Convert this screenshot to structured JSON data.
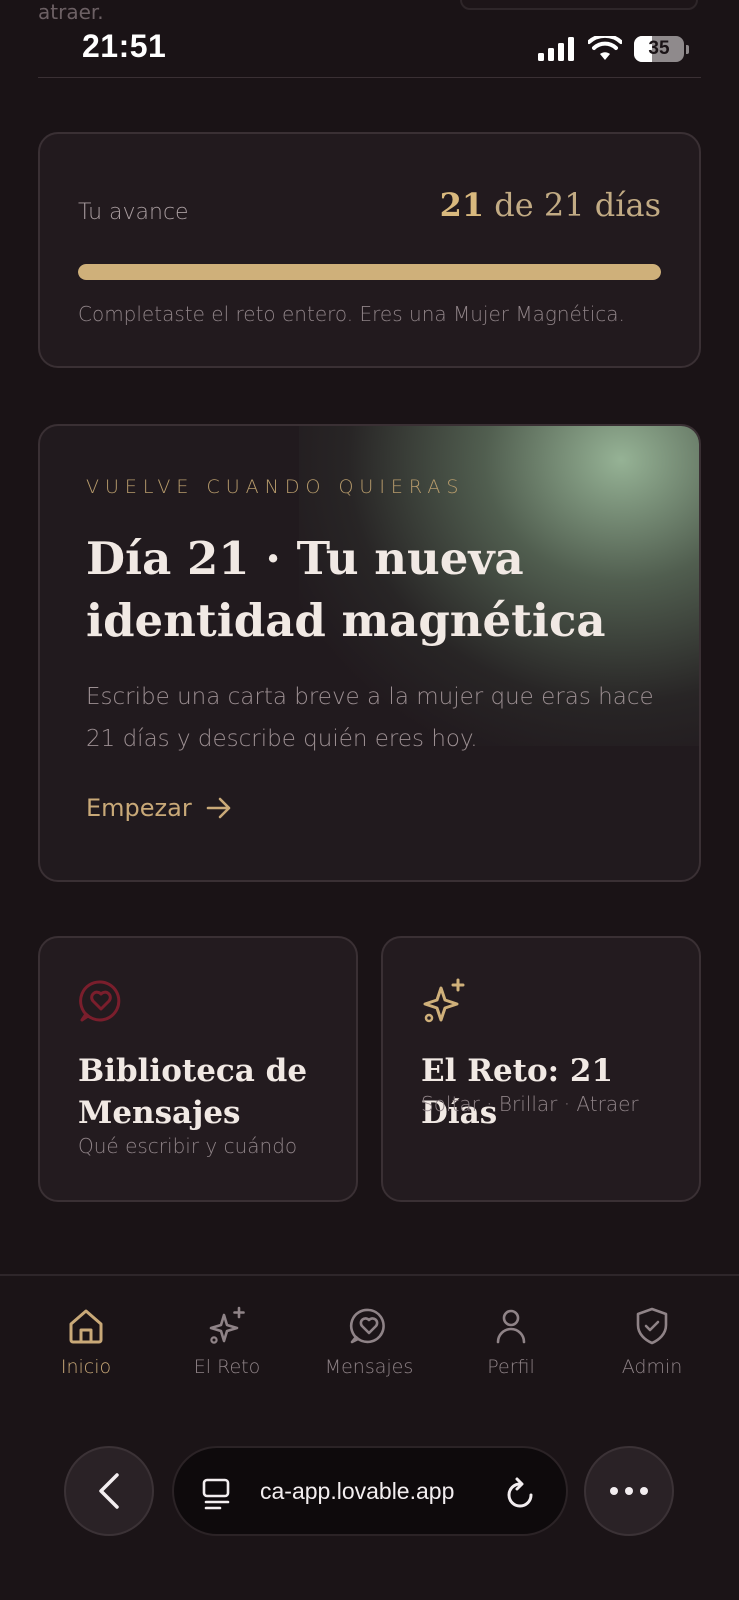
{
  "peek_text": "atraer.",
  "status": {
    "time": "21:51",
    "battery": "35"
  },
  "progress": {
    "label": "Tu avance",
    "current": "21",
    "rest": " de 21 días",
    "fraction": 1.0,
    "message": "Completaste el reto entero. Eres una Mujer Magnética."
  },
  "day": {
    "eyebrow": "VUELVE CUANDO QUIERAS",
    "title": "Día 21 · Tu nueva identidad magnética",
    "description": "Escribe una carta breve a la mujer que eras hace 21 días y describe quién eres hoy.",
    "cta": "Empezar"
  },
  "cards": [
    {
      "title": "Biblioteca de Mensajes",
      "subtitle": "Qué escribir y cuándo",
      "icon": "heart-chat-icon"
    },
    {
      "title": "El Reto: 21 Días",
      "subtitle": "Soltar · Brillar · Atraer",
      "icon": "sparkles-icon"
    }
  ],
  "nav": [
    {
      "label": "Inicio",
      "icon": "home-icon",
      "active": true
    },
    {
      "label": "El Reto",
      "icon": "sparkles-icon",
      "active": false
    },
    {
      "label": "Mensajes",
      "icon": "heart-chat-icon",
      "active": false
    },
    {
      "label": "Perfil",
      "icon": "user-icon",
      "active": false
    },
    {
      "label": "Admin",
      "icon": "shield-check-icon",
      "active": false
    }
  ],
  "browser": {
    "url": "ca-app.lovable.app"
  },
  "colors": {
    "accent": "#cfb07a",
    "background": "#1a1316",
    "heart": "#7a1e2c"
  }
}
